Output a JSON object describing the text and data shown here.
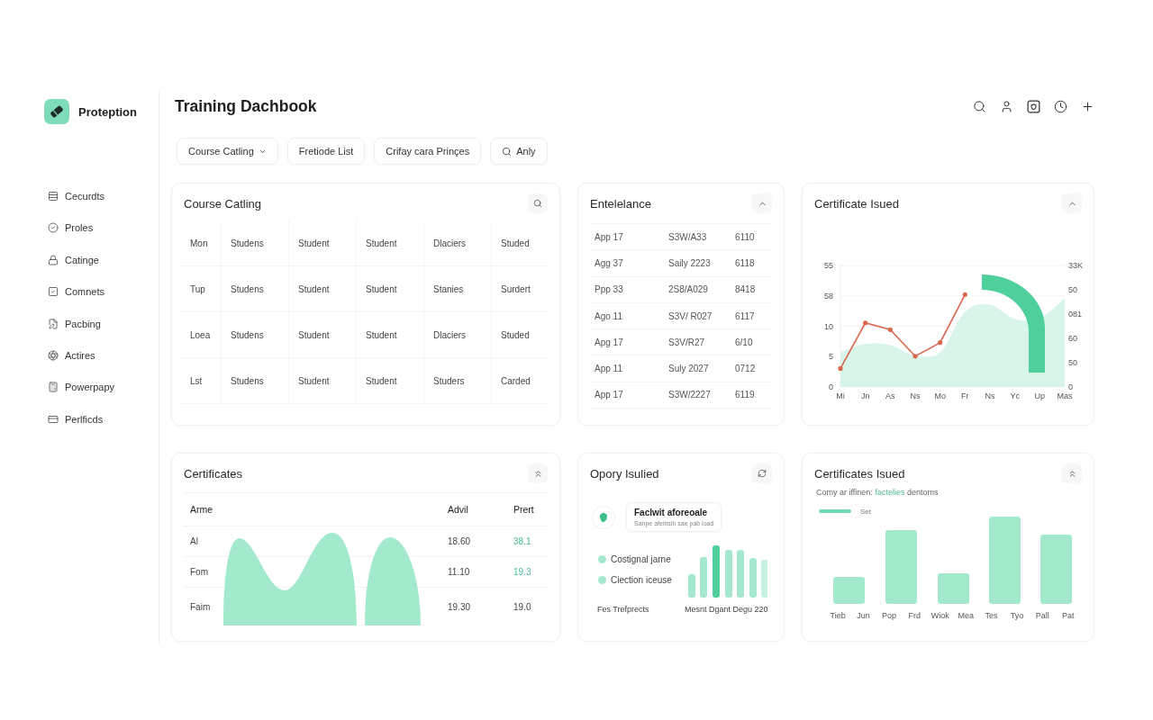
{
  "sidebar": {
    "brand": "Proteption",
    "items": [
      "Cecurdts",
      "Proles",
      "Catinge",
      "Comnets",
      "Pacbing",
      "Actires",
      "Powerpapy",
      "Perlficds"
    ]
  },
  "header": {
    "title": "Training Dachbook"
  },
  "filters": [
    {
      "kind": "dropdown",
      "label": "Course Catling"
    },
    {
      "kind": "plain",
      "label": "Fretiode List"
    },
    {
      "kind": "plain",
      "label": "Crifay cara Prinçes"
    },
    {
      "kind": "search",
      "label": "Anly"
    }
  ],
  "course_catalog": {
    "title": "Course Catling",
    "rows": [
      [
        "Mon",
        "Studens",
        "Student",
        "Student",
        "Dlaciers",
        "Studed"
      ],
      [
        "Tup",
        "Studens",
        "Student",
        "Student",
        "Stanies",
        "Surdert"
      ],
      [
        "Loea",
        "Studens",
        "Student",
        "Student",
        "Dlaciers",
        "Studed"
      ],
      [
        "Lst",
        "Studens",
        "Student",
        "Student",
        "Studers",
        "Carded"
      ]
    ]
  },
  "enrollment": {
    "title": "Entelelance",
    "rows": [
      [
        "App 17",
        "S3W/A33",
        "6110"
      ],
      [
        "Agg 37",
        "Saily 2223",
        "6118"
      ],
      [
        "Ppp 33",
        "2S8/A029",
        "8418"
      ],
      [
        "Ago 11",
        "S3V/ R027",
        "6117"
      ],
      [
        "Apg 17",
        "S3V/R27",
        "6/10"
      ],
      [
        "App 11",
        "Suly 2027",
        "0712"
      ],
      [
        "App 17",
        "S3W/2227",
        "6119"
      ]
    ]
  },
  "certificate_issued": {
    "title": "Certificate Isued",
    "y_axis_labels": [
      "55",
      "58",
      "10",
      "5",
      "0"
    ],
    "right_axis_labels": [
      "33K",
      "50",
      "081",
      "60",
      "50",
      "0"
    ],
    "x_axis_labels": [
      "Mi",
      "Jn",
      "As",
      "Ns",
      "Mo",
      "Fr",
      "Ns",
      "Yc",
      "Up",
      "Mas"
    ]
  },
  "certificates": {
    "title": "Certificates",
    "columns": [
      "Arme",
      "Advil",
      "Prert"
    ],
    "rows": [
      {
        "cells": [
          "Al",
          "18.60",
          "38.1"
        ],
        "highlighted": true
      },
      {
        "cells": [
          "Fom",
          "11.10",
          "19.3"
        ],
        "highlighted": true
      },
      {
        "cells": [
          "Faim",
          "19.30",
          "19.0"
        ],
        "highlighted": false
      }
    ]
  },
  "opory_issued": {
    "title": "Opory Isulied",
    "feature": {
      "title": "Faclwit aforeoale",
      "subtitle": "Sanpe afeinsih sae pab load"
    },
    "legend": [
      "Costignal jarne",
      "Ciection iceuse"
    ],
    "footer": "Fes Trefprects",
    "bars_caption": "Mesnt Dgant Degu 220"
  },
  "certificates_issued": {
    "title": "Certificates Isued",
    "subtitle": {
      "before": "Comy ar iffinen:",
      "link": "factelies",
      "after": "dentoms"
    },
    "legend": "Set",
    "x_labels": [
      "Tieb",
      "Jun",
      "Pop",
      "Frd",
      "Wiok",
      "Mea",
      "Tes",
      "Tyo",
      "Pall",
      "Pat"
    ]
  }
}
